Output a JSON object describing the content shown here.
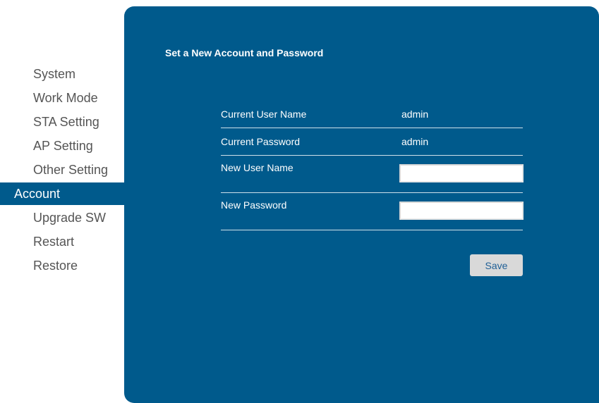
{
  "sidebar": {
    "items": [
      {
        "label": "System"
      },
      {
        "label": "Work Mode"
      },
      {
        "label": "STA Setting"
      },
      {
        "label": "AP Setting"
      },
      {
        "label": "Other Setting"
      },
      {
        "label": "Account",
        "active": true
      },
      {
        "label": "Upgrade SW"
      },
      {
        "label": "Restart"
      },
      {
        "label": "Restore"
      }
    ]
  },
  "panel": {
    "title": "Set a New Account and Password",
    "current_user": {
      "label": "Current User Name",
      "value": "admin"
    },
    "current_password": {
      "label": "Current Password",
      "value": "admin"
    },
    "new_user": {
      "label": "New User Name",
      "value": ""
    },
    "new_password": {
      "label": "New Password",
      "value": ""
    },
    "save_label": "Save"
  },
  "colors": {
    "accent": "#005a8c",
    "sidebar_text": "#555555",
    "button_bg": "#d9d9d9",
    "button_text": "#1f5f96"
  }
}
